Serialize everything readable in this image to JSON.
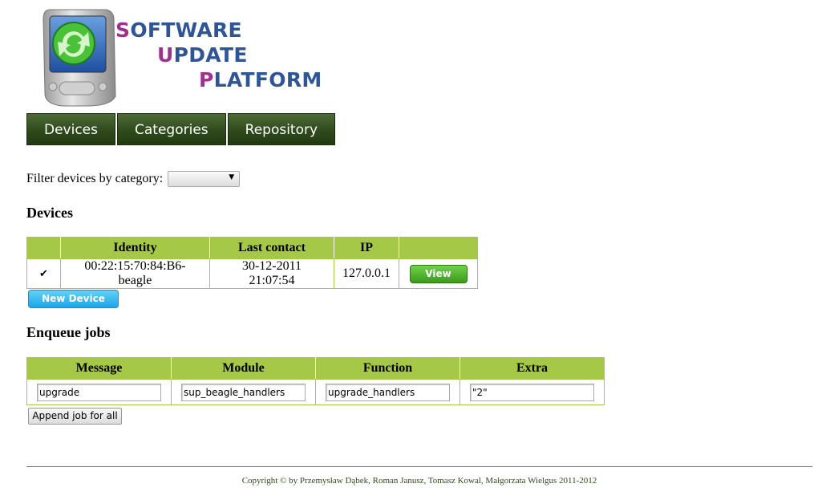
{
  "logo": {
    "line1_first": "S",
    "line1_rest": "OFTWARE",
    "line2_first": "U",
    "line2_rest": "PDATE",
    "line3_first": "P",
    "line3_rest": "LATFORM"
  },
  "nav": {
    "items": [
      "Devices",
      "Categories",
      "Repository"
    ]
  },
  "filter": {
    "label": "Filter devices by category:",
    "selected": ""
  },
  "devices": {
    "heading": "Devices",
    "columns": [
      "",
      "Identity",
      "Last contact",
      "IP",
      ""
    ],
    "rows": [
      {
        "checked": "✔",
        "identity": "00:22:15:70:84:B6-beagle",
        "last_contact": "30-12-2011 21:07:54",
        "ip": "127.0.0.1",
        "action": "View"
      }
    ],
    "new_button": "New Device"
  },
  "jobs": {
    "heading": "Enqueue jobs",
    "columns": [
      "Message",
      "Module",
      "Function",
      "Extra"
    ],
    "values": {
      "message": "upgrade",
      "module": "sup_beagle_handlers",
      "function": "upgrade_handlers",
      "extra": "\"2\""
    },
    "append_button": "Append job for all"
  },
  "footer": {
    "text": "Copyright © by Przemysław Dąbek, Roman Janusz, Tomasz Kowal, Małgorzata Wielgus 2011-2012"
  },
  "colors": {
    "nav_bg": "#2f4a1c",
    "table_header": "#a5c847",
    "view_btn": "#3c9a1c",
    "new_btn": "#1ba6e6",
    "logo_blue": "#2f5597",
    "logo_purple": "#a0308f"
  }
}
